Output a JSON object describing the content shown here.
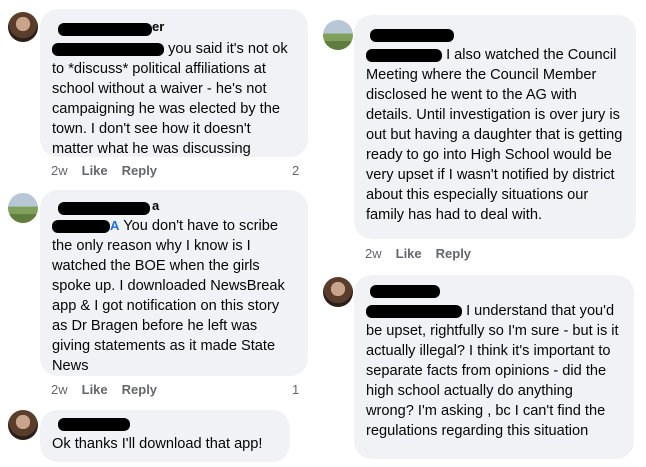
{
  "comments_left": [
    {
      "name_suffix": "er",
      "text": "you said it's not ok to *discuss* political affiliations at school without a waiver - he's not campaigning he was elected by the town. I don't see how it doesn't matter what he was discussing",
      "time": "2w",
      "like": "Like",
      "reply": "Reply",
      "reaction_count": "2"
    },
    {
      "name_suffix": "a",
      "tag_suffix": "A",
      "text": "You don't have to scribe the only reason why I know is I watched the BOE when the girls spoke up.  I downloaded NewsBreak app & I got notification on this story as Dr Bragen before he left was giving statements as it made State News",
      "time": "2w",
      "like": "Like",
      "reply": "Reply",
      "reaction_count": "1"
    },
    {
      "text": "Ok thanks I'll download that app!"
    }
  ],
  "comments_right": [
    {
      "text": "I also watched the Council Meeting where the Council Member disclosed he went to the AG with details.  Until investigation is over jury is out but having a daughter that is getting ready to go into High School would be very upset if I wasn't notified by district about this especially situations our family has had to deal with.",
      "time": "2w",
      "like": "Like",
      "reply": "Reply"
    },
    {
      "text": "I understand that you'd be upset, rightfully so I'm sure - but is it actually illegal? I think it's important to separate facts from opinions - did the high school actually do anything wrong? I'm asking , bc I can't find the regulations regarding this situation"
    }
  ]
}
